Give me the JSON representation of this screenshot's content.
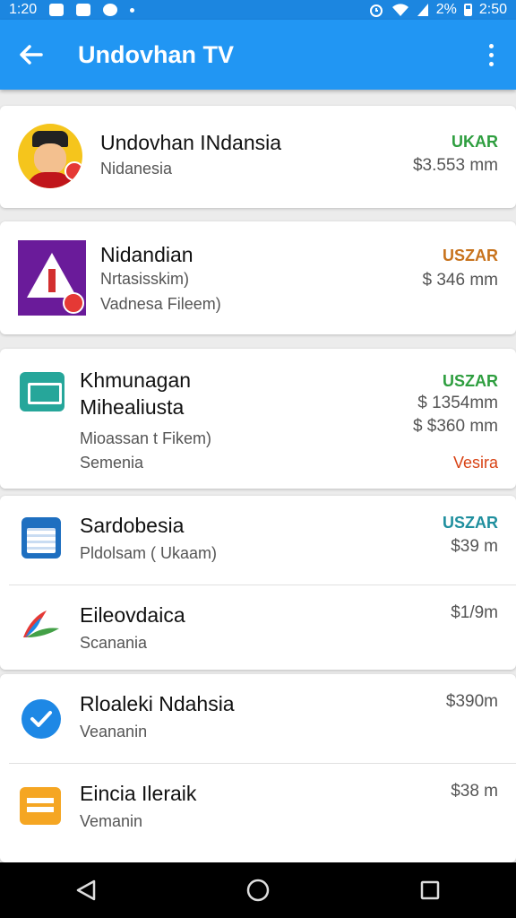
{
  "status_bar": {
    "time_left": "1:20",
    "battery": "2%",
    "time_right": "2:50"
  },
  "app_bar": {
    "title": "Undovhan TV"
  },
  "items": [
    {
      "name": "Undovhan INdansia",
      "sub1": "Nidanesia",
      "tag": "UKAR",
      "tag_color": "#2e9e3f",
      "price1": "$3.553 mm"
    },
    {
      "name": "Nidandian",
      "sub1": "Nrtasisskim)",
      "sub2": "Vadnesa Fileem)",
      "tag": "USZAR",
      "tag_color": "#c8731d",
      "price1": "$ 346  mm"
    },
    {
      "name_line1": "Khmunagan",
      "name_line2": "Mihealiusta",
      "sub1": "Mioassan t Fikem)",
      "sub2": "Semenia",
      "tag": "USZAR",
      "tag_color": "#2e9e3f",
      "price1": "$ 1354mm",
      "price2": "$ $360 mm",
      "tag2": "Vesira",
      "tag2_color": "#d84315"
    },
    {
      "name": "Sardobesia",
      "sub1": "Pldolsam ( Ukaam)",
      "tag": "USZAR",
      "tag_color": "#1f8f9e",
      "price1": "$39  m"
    },
    {
      "name": "Eileovdaica",
      "sub1": "Scanania",
      "price1": "$1/9m"
    },
    {
      "name": "Rloaleki Ndahsia",
      "sub1": "Veananin",
      "price1": "$390m"
    },
    {
      "name": "Eincia Ileraik",
      "sub1": "Vemanin",
      "price1": "$38 m"
    }
  ],
  "icons": {
    "back": "arrow-left-icon",
    "menu": "more-vert-icon",
    "nav_back": "triangle-back-icon",
    "nav_home": "circle-home-icon",
    "nav_recent": "square-recent-icon"
  },
  "colors": {
    "app_bar": "#2196f3",
    "status_bar": "#1c86e0"
  }
}
